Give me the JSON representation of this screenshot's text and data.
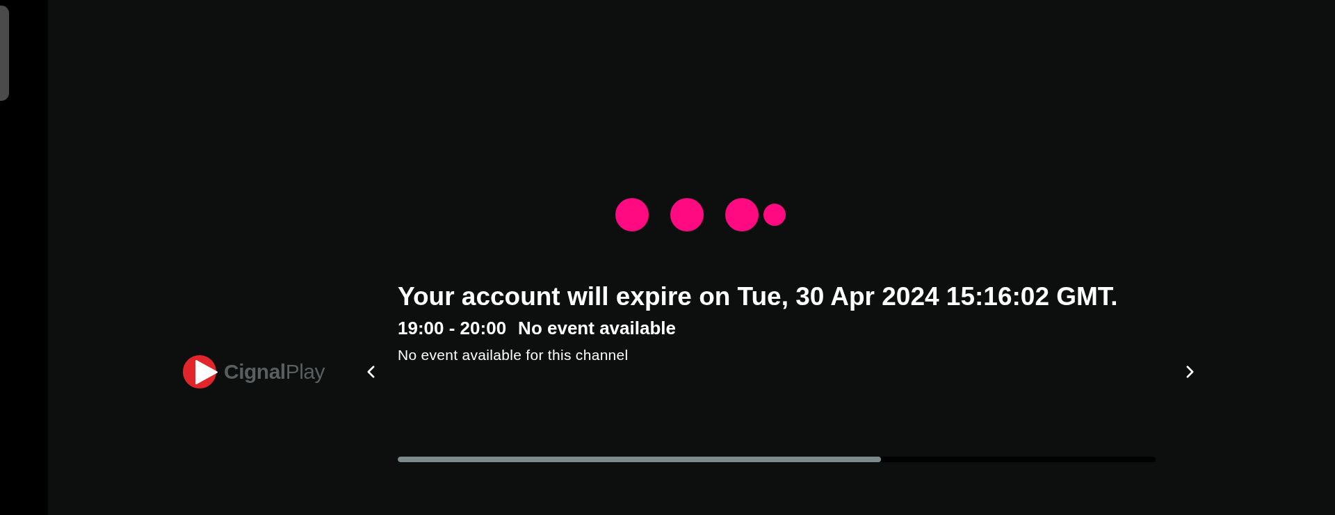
{
  "notice": "Your account will expire on Tue, 30 Apr 2024 15:16:02 GMT.",
  "channel": {
    "logo_text": "**Cignal**Play"
  },
  "program": {
    "time": "19:00 - 20:00",
    "title": "No event available",
    "description": "No event available for this channel",
    "level": 0.638
  }
}
